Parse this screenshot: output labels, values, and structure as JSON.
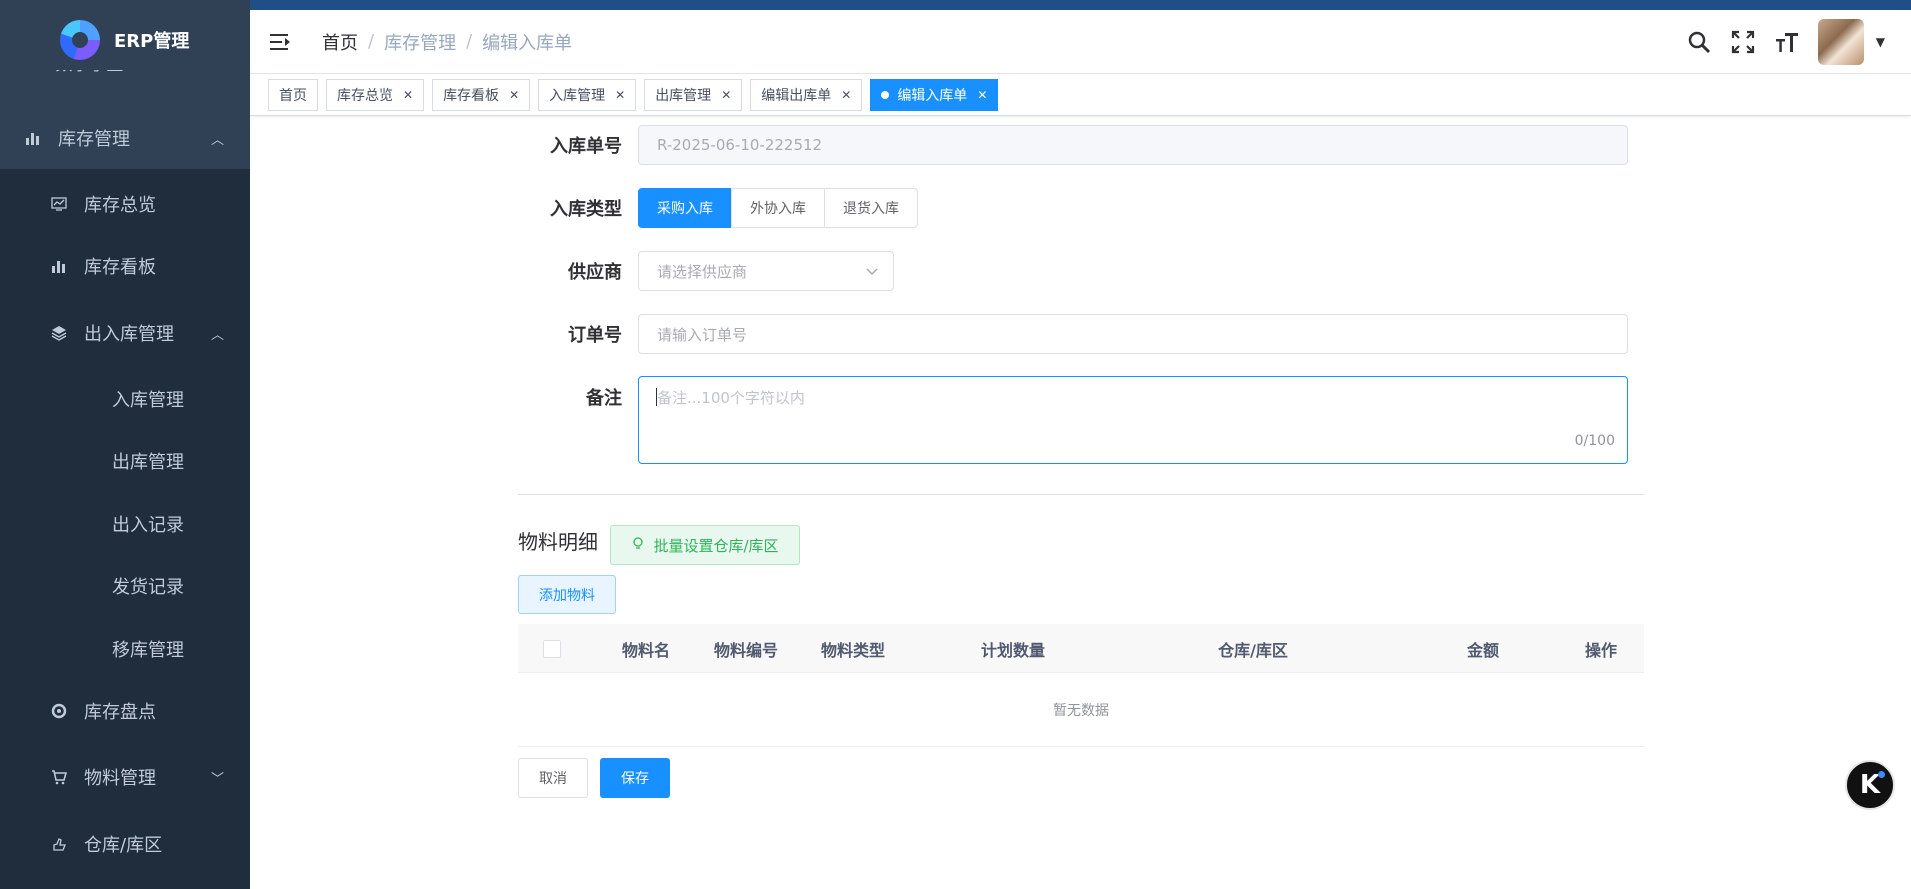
{
  "app": {
    "brand_name": "ERP管理",
    "brand_clipped_item": "BIM数字孪生"
  },
  "sidebar": {
    "inventory_group": "库存管理",
    "items": [
      {
        "label": "库存总览",
        "icon": "chart-line-icon"
      },
      {
        "label": "库存看板",
        "icon": "bar-chart-icon"
      }
    ],
    "inout_group": "出入库管理",
    "inout_items": [
      "入库管理",
      "出库管理",
      "出入记录",
      "发货记录",
      "移库管理"
    ],
    "stocktake": "库存盘点",
    "material": "物料管理",
    "warehouse": "仓库/库区"
  },
  "header": {
    "breadcrumb": [
      "首页",
      "库存管理",
      "编辑入库单"
    ]
  },
  "tags": [
    {
      "label": "首页",
      "closable": false,
      "active": false
    },
    {
      "label": "库存总览",
      "closable": true,
      "active": false
    },
    {
      "label": "库存看板",
      "closable": true,
      "active": false
    },
    {
      "label": "入库管理",
      "closable": true,
      "active": false
    },
    {
      "label": "出库管理",
      "closable": true,
      "active": false
    },
    {
      "label": "编辑出库单",
      "closable": true,
      "active": false
    },
    {
      "label": "编辑入库单",
      "closable": true,
      "active": true
    }
  ],
  "form": {
    "order_no_label": "入库单号",
    "order_no_value": "R-2025-06-10-222512",
    "type_label": "入库类型",
    "type_options": [
      "采购入库",
      "外协入库",
      "退货入库"
    ],
    "type_selected": "采购入库",
    "supplier_label": "供应商",
    "supplier_placeholder": "请选择供应商",
    "po_label": "订单号",
    "po_placeholder": "请输入订单号",
    "remark_label": "备注",
    "remark_placeholder": "备注...100个字符以内",
    "remark_count": "0/100"
  },
  "materials": {
    "title": "物料明细",
    "batch_button": "批量设置仓库/库区",
    "add_button": "添加物料",
    "columns": [
      "物料名",
      "物料编号",
      "物料类型",
      "计划数量",
      "仓库/库区",
      "金额",
      "操作"
    ],
    "empty_text": "暂无数据"
  },
  "actions": {
    "cancel": "取消",
    "save": "保存"
  },
  "colors": {
    "primary": "#1890ff",
    "sidebar_bg": "#304156",
    "success": "#30b35b"
  }
}
